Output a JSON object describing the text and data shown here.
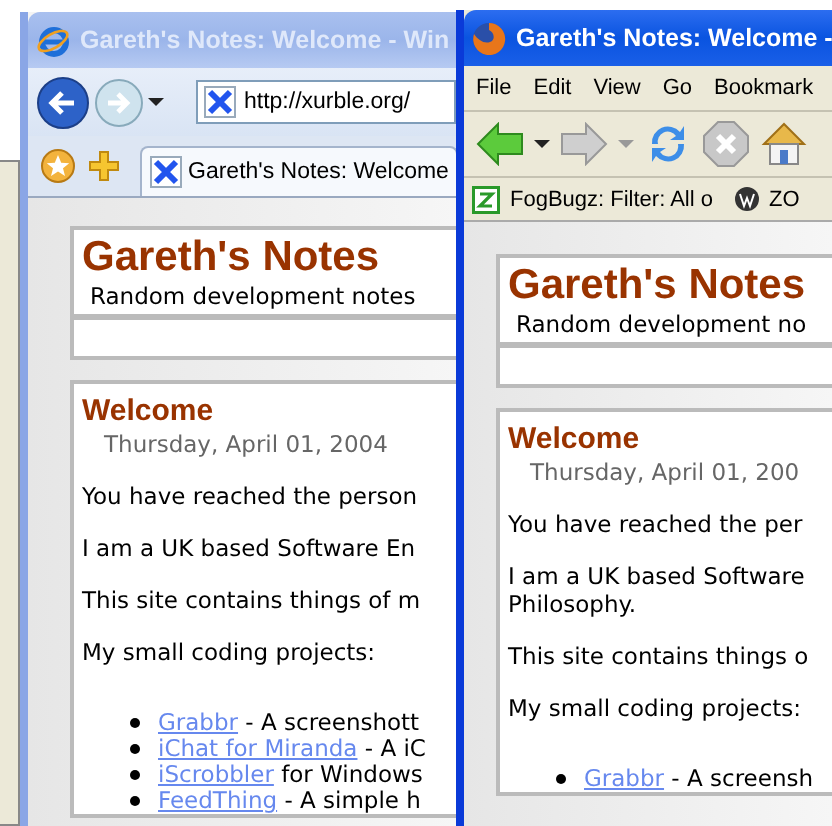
{
  "windows": [
    {
      "kind": "ie",
      "active": false,
      "title": "Gareth's Notes: Welcome - Win",
      "address": "http://xurble.org/",
      "tab": "Gareth's Notes: Welcome",
      "page": {
        "site_title": "Gareth's Notes",
        "tagline": "Random development notes",
        "post_title": "Welcome",
        "date": "Thursday, April 01, 2004",
        "paragraphs": [
          [
            "You have reached the person"
          ],
          [
            "I am a UK based Software En"
          ],
          [
            "This site contains things of m"
          ],
          [
            "My small coding projects:"
          ]
        ],
        "projects": [
          {
            "link": "Grabbr",
            "text": " - A screenshott"
          },
          {
            "link": "iChat for Miranda",
            "text": " - A iC"
          },
          {
            "link": "iScrobbler",
            "text": " for Windows"
          },
          {
            "link": "FeedThing",
            "text": " - A simple h"
          }
        ]
      }
    },
    {
      "kind": "firefox",
      "active": true,
      "title": "Gareth's Notes: Welcome -",
      "menu": [
        "File",
        "Edit",
        "View",
        "Go",
        "Bookmark"
      ],
      "bookmarks": [
        "FogBugz: Filter: All o",
        "ZO"
      ],
      "page": {
        "site_title": "Gareth's Notes",
        "tagline": "Random development no",
        "post_title": "Welcome",
        "date": "Thursday, April 01, 200",
        "paragraphs": [
          [
            "You have reached the per"
          ],
          [
            "I am a UK based Software",
            "Philosophy."
          ],
          [
            "This site contains things o"
          ],
          [
            "My small coding projects:"
          ]
        ],
        "projects": [
          {
            "link": "Grabbr",
            "text": " - A screensh"
          }
        ]
      }
    }
  ]
}
